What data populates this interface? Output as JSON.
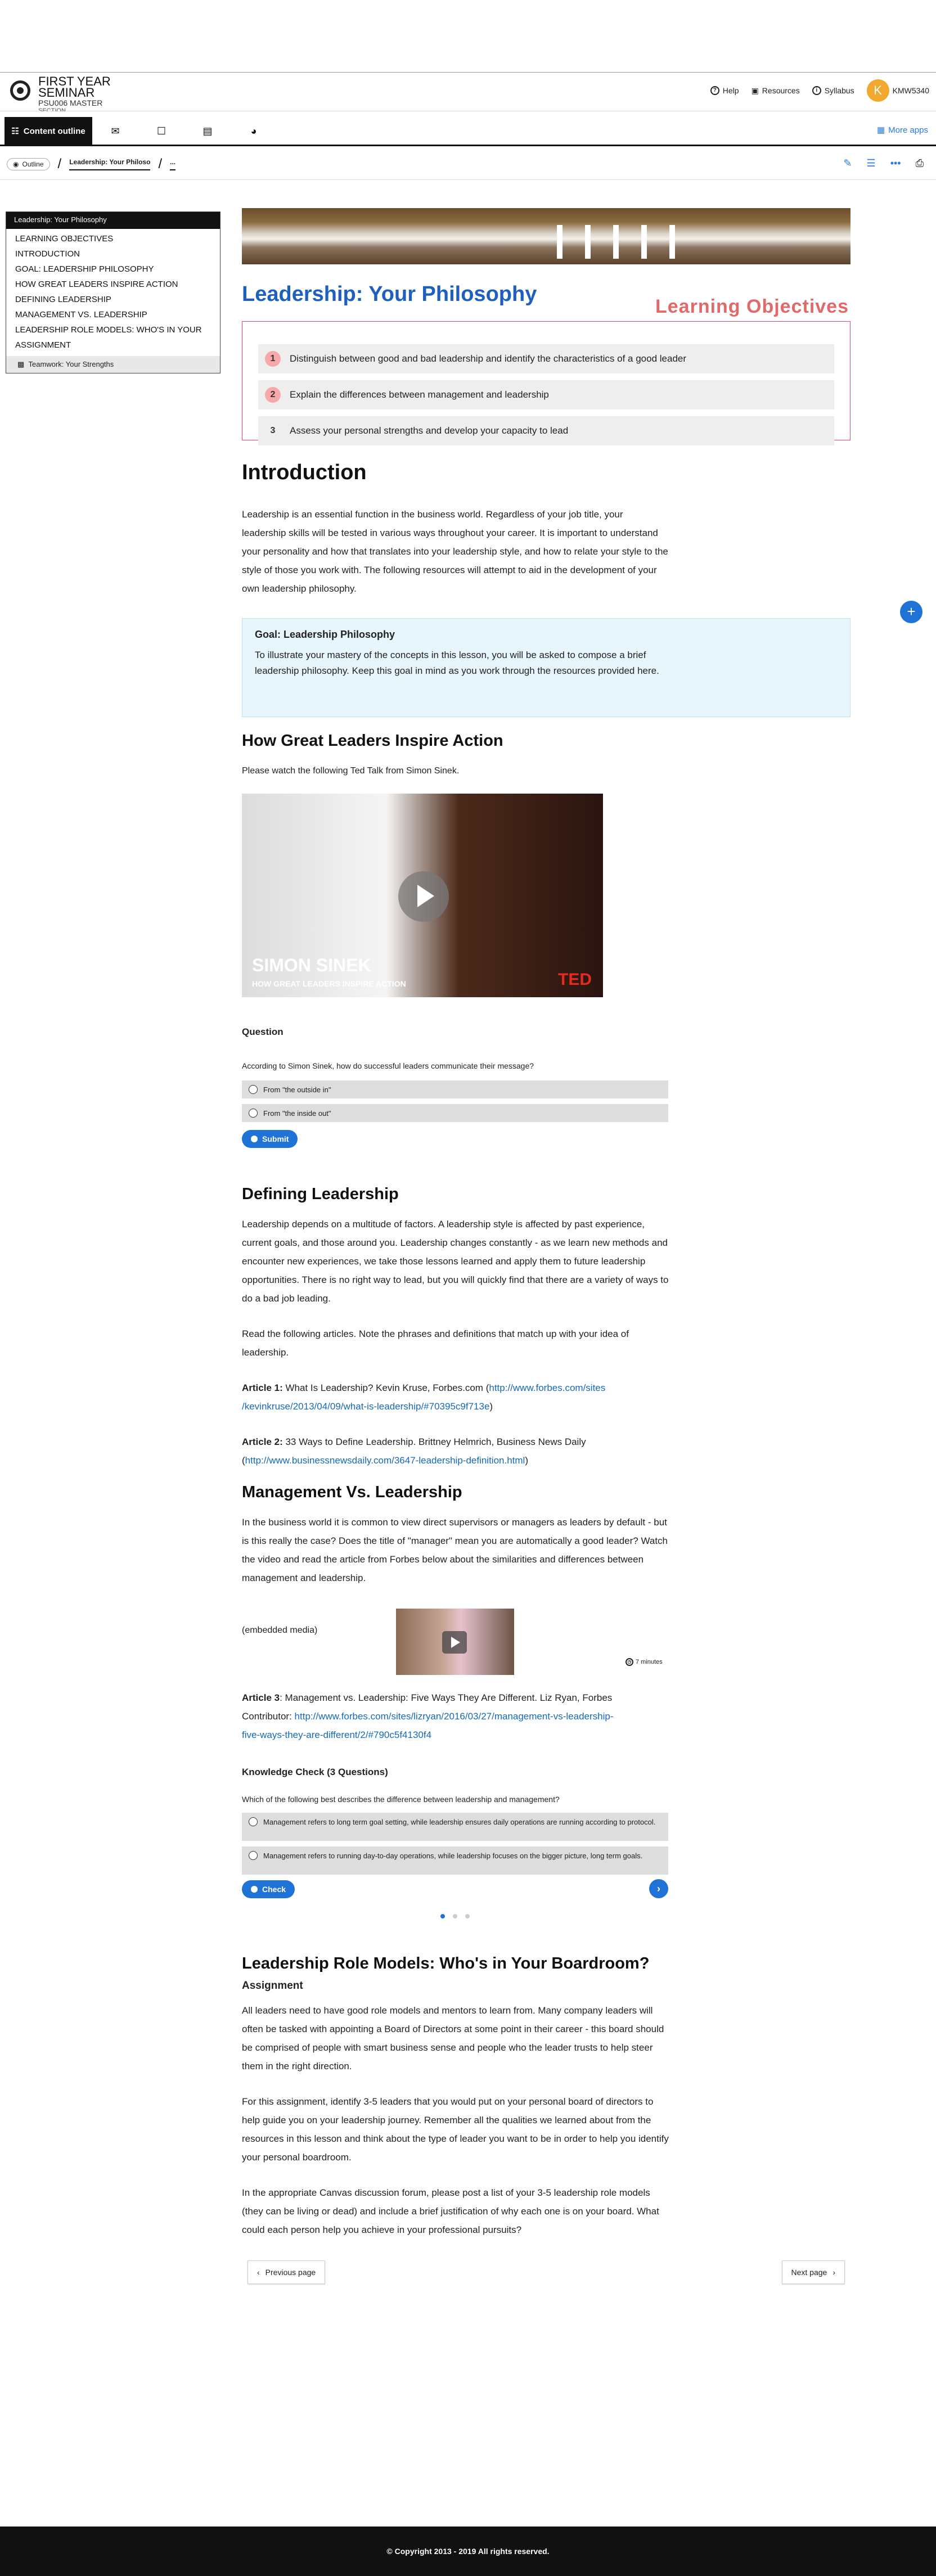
{
  "header": {
    "course_title": "FIRST YEAR",
    "course_title2": "SEMINAR",
    "course_code": "PSU006 MASTER",
    "course_section": "SECTION",
    "help": "Help",
    "resources": "Resources",
    "syllabus": "Syllabus",
    "avatar_letter": "K",
    "user": "KMW5340"
  },
  "nav": {
    "content_outline": "Content outline",
    "more_apps": "More apps"
  },
  "crumb": {
    "outline": "Outline",
    "current": "Leadership: Your Philoso",
    "more": "..."
  },
  "outline": {
    "header": "Leadership: Your Philosophy",
    "items": [
      "LEARNING OBJECTIVES",
      "INTRODUCTION",
      "GOAL: LEADERSHIP PHILOSOPHY",
      "HOW GREAT LEADERS INSPIRE ACTION",
      "DEFINING LEADERSHIP",
      "MANAGEMENT VS. LEADERSHIP",
      "LEADERSHIP ROLE MODELS: WHO'S IN YOUR",
      "ASSIGNMENT"
    ],
    "sub": "Teamwork: Your Strengths"
  },
  "page": {
    "title": "Leadership: Your Philosophy",
    "lo_label": "Learning Objectives",
    "objectives": [
      {
        "num": "1",
        "text": "Distinguish between good and bad leadership and identify the characteristics of a good leader"
      },
      {
        "num": "2",
        "text": "Explain the differences between management and leadership"
      },
      {
        "num": "3",
        "text": "Assess your personal strengths and develop your capacity to lead"
      }
    ],
    "intro_h": "Introduction",
    "intro_p": "Leadership is an essential function in the business world. Regardless of your job title, your leadership skills will be tested in various ways throughout your career. It is important to understand your personality and how that translates into your leadership style, and how to relate your style to the style of those you work with. The following resources will attempt to aid in the development of your own leadership philosophy.",
    "goal_t": "Goal: Leadership Philosophy",
    "goal_b": "To illustrate your mastery of the concepts in this lesson, you will be asked to compose a brief leadership philosophy. Keep this goal in mind as you work through the resources provided here.",
    "inspire_h": "How Great Leaders Inspire Action",
    "inspire_p": "Please watch the following Ted Talk from Simon Sinek.",
    "video_name": "SIMON SINEK",
    "video_sub": "HOW GREAT LEADERS INSPIRE ACTION",
    "video_brand": "TED",
    "q_label": "Question",
    "q_text": "According to Simon Sinek, how do successful leaders communicate their message?",
    "q_opt1": "From \"the outside in\"",
    "q_opt2": "From \"the inside out\"",
    "submit": "Submit",
    "def_h": "Defining Leadership",
    "def_p": "Leadership depends on a multitude of factors. A leadership style is affected by past experience, current goals, and those around you. Leadership changes constantly - as we learn new methods and encounter new experiences, we take those lessons learned and apply them to future leadership opportunities. There is no right way to lead, but you will quickly find that there are a variety of ways to do a bad job leading.",
    "def_p2": "Read the following articles. Note the phrases and definitions that match up with your idea of leadership.",
    "a1_label": "Article 1:",
    "a1_text": " What Is Leadership? Kevin Kruse, Forbes.com (",
    "a1_link1": "http://www.forbes.com/sites",
    "a1_link2": "/kevinkruse/2013/04/09/what-is-leadership/#70395c9f713e",
    "a1_close": ")",
    "a2_label": "Article 2:",
    "a2_text": " 33 Ways to Define Leadership. Brittney Helmrich, Business News Daily",
    "a2_open": "(",
    "a2_link": "http://www.businessnewsdaily.com/3647-leadership-definition.html",
    "a2_close": ")",
    "mgmt_h": "Management Vs. Leadership",
    "mgmt_p": "In the business world it is common to view direct supervisors or managers as leaders by default - but is this really the case? Does the title of \"manager\" mean you are automatically a good leader? Watch the video and read the article from Forbes below about the similarities and differences between management and leadership.",
    "embedded": "(embedded media)",
    "duration": "7 minutes",
    "a3_label": "Article 3",
    "a3_text": ": Management vs. Leadership: Five Ways They Are Different. Liz Ryan, Forbes",
    "a3_contrib": "Contributor: ",
    "a3_link1": "http://www.forbes.com/sites/lizryan/2016/03/27/management-vs-leadership-",
    "a3_link2": "five-ways-they-are-different/2/#790c5f4130f4",
    "kc_h": "Knowledge Check (3 Questions)",
    "kc_q": "Which of the following best describes the difference between leadership and management?",
    "kc_opt1": "Management refers to long term goal setting, while leadership ensures daily operations are running according to protocol.",
    "kc_opt2": "Management refers to running day-to-day operations, while leadership focuses on the bigger picture, long term goals.",
    "check": "Check",
    "role_h": "Leadership Role Models: Who's in Your Boardroom?",
    "assign_h": "Assignment",
    "role_p1": "All leaders need to have good role models and mentors to learn from. Many company leaders will often be tasked with appointing a Board of Directors at some point in their career - this board should be comprised of people with smart business sense and people who the leader trusts to help steer them in the right direction.",
    "role_p2": "For this assignment, identify 3-5 leaders that you would put on your personal board of directors to help guide you on your leadership journey. Remember all the qualities we learned about from the resources in this lesson and think about the type of leader you want to be in order to help you identify your personal boardroom.",
    "role_p3": "In the appropriate Canvas discussion forum, please post a list of your 3-5 leadership role models (they can be living or dead) and include a brief justification of why each one is on your board. What could each person help you achieve in your professional pursuits?",
    "prev": "Previous page",
    "next": "Next page"
  },
  "footer": {
    "copyright": "© Copyright 2013 - 2019  All rights reserved."
  },
  "colors": {
    "accent": "#1f73d6",
    "title_blue": "#1f5fbf",
    "objectives_red": "#e06a6a",
    "link": "#1569b8"
  }
}
